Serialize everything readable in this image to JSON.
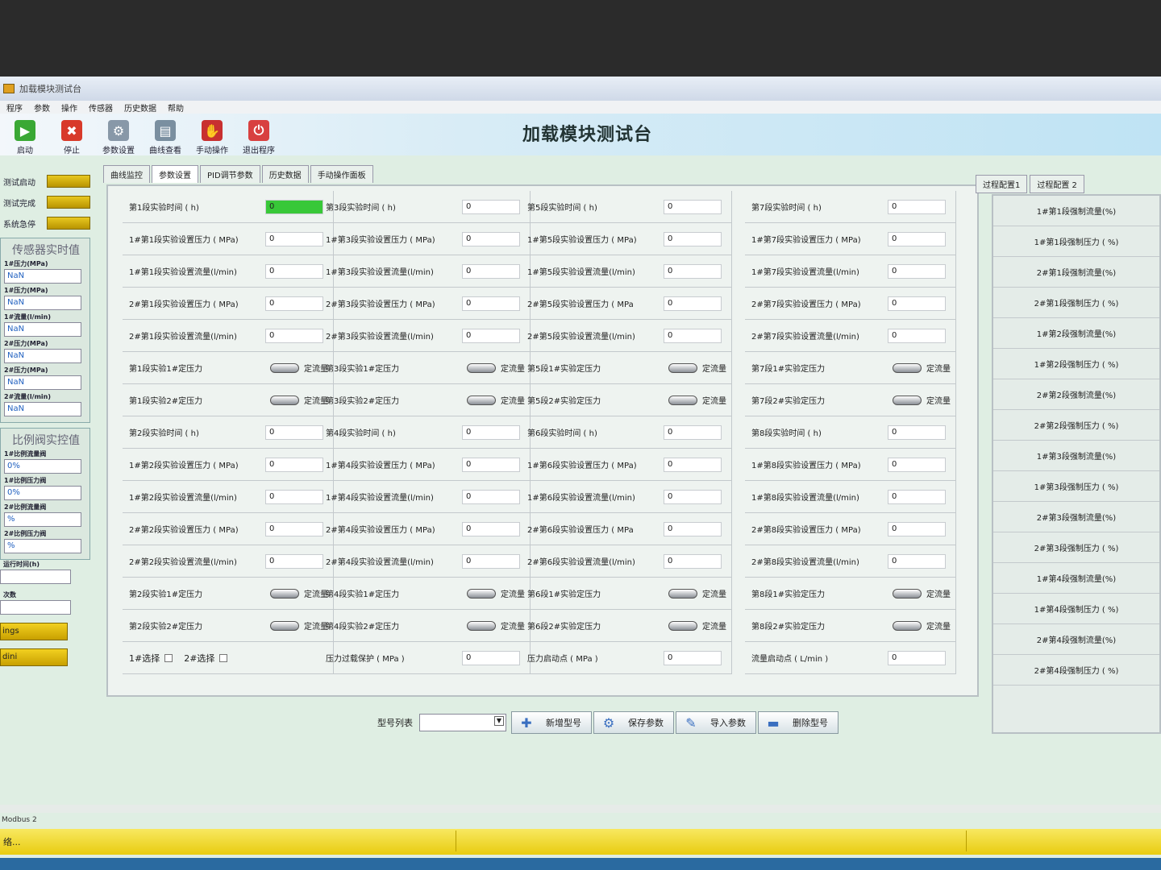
{
  "window_title": "加载模块测试台",
  "menu": [
    "程序",
    "参数",
    "操作",
    "传感器",
    "历史数据",
    "帮助"
  ],
  "toolbar": [
    {
      "label": "启动",
      "icon": "play-icon",
      "color": "#3aa834"
    },
    {
      "label": "停止",
      "icon": "stop-icon",
      "color": "#d83a2a"
    },
    {
      "label": "参数设置",
      "icon": "gear-icon",
      "color": "#8898a8"
    },
    {
      "label": "曲线查看",
      "icon": "chart-icon",
      "color": "#7a8fa0"
    },
    {
      "label": "手动操作",
      "icon": "hand-icon",
      "color": "#c83030"
    },
    {
      "label": "退出程序",
      "icon": "power-icon",
      "color": "#d84040"
    }
  ],
  "app_title": "加载模块测试台",
  "status_lights": [
    {
      "label": "测试启动",
      "color": "#d4b400"
    },
    {
      "label": "测试完成",
      "color": "#d4b400"
    },
    {
      "label": "系统急停",
      "color": "#d4b400"
    }
  ],
  "sensors": {
    "title": "传感器实时值",
    "items": [
      {
        "label": "1#压力(MPa)",
        "value": "NaN"
      },
      {
        "label": "1#压力(MPa)",
        "value": "NaN"
      },
      {
        "label": "1#流量(l/min)",
        "value": "NaN"
      },
      {
        "label": "2#压力(MPa)",
        "value": "NaN"
      },
      {
        "label": "2#压力(MPa)",
        "value": "NaN"
      },
      {
        "label": "2#流量(l/min)",
        "value": "NaN"
      }
    ]
  },
  "valves": {
    "title": "比例阀实控值",
    "items": [
      {
        "label": "1#比例流量阀",
        "value": "0%"
      },
      {
        "label": "1#比例压力阀",
        "value": "0%"
      },
      {
        "label": "2#比例流量阀",
        "value": "%"
      },
      {
        "label": "2#比例压力阀",
        "value": "%"
      }
    ],
    "extra": [
      {
        "label": "运行时间(h)"
      },
      {
        "label": "次数"
      }
    ]
  },
  "yellow_buttons": [
    "ings",
    "dini"
  ],
  "tabs": [
    "曲线监控",
    "参数设置",
    "PID调节参数",
    "历史数据",
    "手动操作面板"
  ],
  "active_tab": 1,
  "columns": [
    {
      "rows": [
        {
          "label": "第1段实验时间 ( h)",
          "value": "0",
          "green": true
        },
        {
          "label": "1#第1段实验设置压力 ( MPa)",
          "value": "0"
        },
        {
          "label": "1#第1段实验设置流量(l/min)",
          "value": "0"
        },
        {
          "label": "2#第1段实验设置压力 ( MPa)",
          "value": "0"
        },
        {
          "label": "2#第1段实验设置流量(l/min)",
          "value": "0"
        },
        {
          "label": "第1段实验1#定压力",
          "toggle": "定流量"
        },
        {
          "label": "第1段实验2#定压力",
          "toggle": "定流量"
        },
        {
          "label": "第2段实验时间 ( h)",
          "value": "0"
        },
        {
          "label": "1#第2段实验设置压力 ( MPa)",
          "value": "0"
        },
        {
          "label": "1#第2段实验设置流量(l/min)",
          "value": "0"
        },
        {
          "label": "2#第2段实验设置压力 ( MPa)",
          "value": "0"
        },
        {
          "label": "2#第2段实验设置流量(l/min)",
          "value": "0"
        },
        {
          "label": "第2段实验1#定压力",
          "toggle": "定流量"
        },
        {
          "label": "第2段实验2#定压力",
          "toggle": "定流量"
        }
      ],
      "footer": {
        "chk1": "1#选择",
        "chk2": "2#选择"
      }
    },
    {
      "rows": [
        {
          "label": "第3段实验时间 ( h)",
          "value": "0"
        },
        {
          "label": "1#第3段实验设置压力 ( MPa)",
          "value": "0"
        },
        {
          "label": "1#第3段实验设置流量(l/min)",
          "value": "0"
        },
        {
          "label": "2#第3段实验设置压力 ( MPa)",
          "value": "0"
        },
        {
          "label": "2#第3段实验设置流量(l/min)",
          "value": "0"
        },
        {
          "label": "第3段实验1#定压力",
          "toggle": "定流量"
        },
        {
          "label": "第3段实验2#定压力",
          "toggle": "定流量"
        },
        {
          "label": "第4段实验时间 ( h)",
          "value": "0"
        },
        {
          "label": "1#第4段实验设置压力 ( MPa)",
          "value": "0"
        },
        {
          "label": "1#第4段实验设置流量(l/min)",
          "value": "0"
        },
        {
          "label": "2#第4段实验设置压力 ( MPa)",
          "value": "0"
        },
        {
          "label": "2#第4段实验设置流量(l/min)",
          "value": "0"
        },
        {
          "label": "第4段实验1#定压力",
          "toggle": "定流量"
        },
        {
          "label": "第4段实验2#定压力",
          "toggle": "定流量"
        }
      ],
      "footer": {
        "label": "压力过载保护 ( MPa )",
        "value": "0"
      }
    },
    {
      "rows": [
        {
          "label": "第5段实验时间 ( h)",
          "value": "0"
        },
        {
          "label": "1#第5段实验设置压力 ( MPa)",
          "value": "0"
        },
        {
          "label": "1#第5段实验设置流量(l/min)",
          "value": "0"
        },
        {
          "label": "2#第5段实验设置压力 ( MPa",
          "value": "0"
        },
        {
          "label": "2#第5段实验设置流量(l/min)",
          "value": "0"
        },
        {
          "label": "第5段1#实验定压力",
          "toggle": "定流量"
        },
        {
          "label": "第5段2#实验定压力",
          "toggle": "定流量"
        },
        {
          "label": "第6段实验时间 ( h)",
          "value": "0"
        },
        {
          "label": "1#第6段实验设置压力 ( MPa)",
          "value": "0"
        },
        {
          "label": "1#第6段实验设置流量(l/min)",
          "value": "0"
        },
        {
          "label": "2#第6段实验设置压力 ( MPa",
          "value": "0"
        },
        {
          "label": "2#第6段实验设置流量(l/min)",
          "value": "0"
        },
        {
          "label": "第6段1#实验定压力",
          "toggle": "定流量"
        },
        {
          "label": "第6段2#实验定压力",
          "toggle": "定流量"
        }
      ],
      "footer": {
        "label": "压力启动点 ( MPa )",
        "value": "0"
      }
    },
    {
      "rows": [
        {
          "label": "第7段实验时间 ( h)",
          "value": "0"
        },
        {
          "label": "1#第7段实验设置压力 ( MPa)",
          "value": "0"
        },
        {
          "label": "1#第7段实验设置流量(l/min)",
          "value": "0"
        },
        {
          "label": "2#第7段实验设置压力 ( MPa)",
          "value": "0"
        },
        {
          "label": "2#第7段实验设置流量(l/min)",
          "value": "0"
        },
        {
          "label": "第7段1#实验定压力",
          "toggle": "定流量"
        },
        {
          "label": "第7段2#实验定压力",
          "toggle": "定流量"
        },
        {
          "label": "第8段实验时间 ( h)",
          "value": "0"
        },
        {
          "label": "1#第8段实验设置压力 ( MPa)",
          "value": "0"
        },
        {
          "label": "1#第8段实验设置流量(l/min)",
          "value": "0"
        },
        {
          "label": "2#第8段实验设置压力 ( MPa)",
          "value": "0"
        },
        {
          "label": "2#第8段实验设置流量(l/min)",
          "value": "0"
        },
        {
          "label": "第8段1#实验定压力",
          "toggle": "定流量"
        },
        {
          "label": "第8段2#实验定压力",
          "toggle": "定流量"
        }
      ],
      "footer": {
        "label": "流量启动点 ( L/min )",
        "value": "0"
      }
    }
  ],
  "bottom": {
    "model_list_label": "型号列表",
    "buttons": [
      {
        "label": "新增型号",
        "icon": "plus-icon",
        "glyph": "✚"
      },
      {
        "label": "保存参数",
        "icon": "gear-icon",
        "glyph": "⚙"
      },
      {
        "label": "导入参数",
        "icon": "import-icon",
        "glyph": "✎"
      },
      {
        "label": "删除型号",
        "icon": "minus-icon",
        "glyph": "▬"
      }
    ]
  },
  "right_tabs": [
    "过程配置1",
    "过程配置 2"
  ],
  "right_items": [
    "1#第1段强制流量(%)",
    "1#第1段强制压力 ( %)",
    "2#第1段强制流量(%)",
    "2#第1段强制压力 ( %)",
    "1#第2段强制流量(%)",
    "1#第2段强制压力 ( %)",
    "2#第2段强制流量(%)",
    "2#第2段强制压力 ( %)",
    "1#第3段强制流量(%)",
    "1#第3段强制压力 ( %)",
    "2#第3段强制流量(%)",
    "2#第3段强制压力 ( %)",
    "1#第4段强制流量(%)",
    "1#第4段强制压力 ( %)",
    "2#第4段强制流量(%)",
    "2#第4段强制压力 ( %)"
  ],
  "status": {
    "line2": "Modbus 2",
    "text": "络..."
  }
}
